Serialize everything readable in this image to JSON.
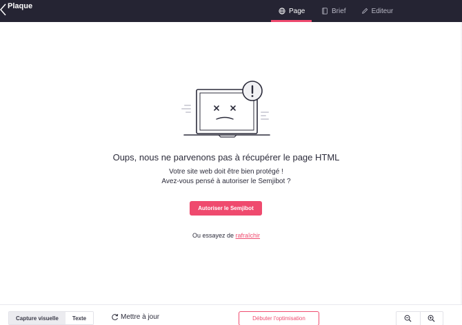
{
  "header": {
    "app_title": "Plaque",
    "tabs": [
      {
        "label": "Page",
        "icon": "globe-icon",
        "active": true
      },
      {
        "label": "Brief",
        "icon": "book-icon",
        "active": false
      },
      {
        "label": "Editeur",
        "icon": "pencil-icon",
        "active": false
      }
    ]
  },
  "error": {
    "title": "Oups, nous ne parvenons pas à récupérer le page HTML",
    "line1": "Votre site web doit être bien protégé !",
    "line2": "Avez-vous pensé à autoriser le Semjibot ?",
    "button_label": "Autoriser le Semjibot",
    "retry_prefix": "Ou essayez de ",
    "retry_link": "rafraîchir"
  },
  "footer": {
    "view_options": [
      {
        "label": "Capture visuelle",
        "active": true
      },
      {
        "label": "Texte",
        "active": false
      }
    ],
    "refresh_label": "Mettre à jour",
    "start_button": "Débuter l'optimisation",
    "zoom": [
      "zoom-out-icon",
      "zoom-in-icon"
    ]
  },
  "colors": {
    "header_bg": "#252433",
    "accent": "#ef4a6e",
    "text": "#2b2b3a"
  }
}
